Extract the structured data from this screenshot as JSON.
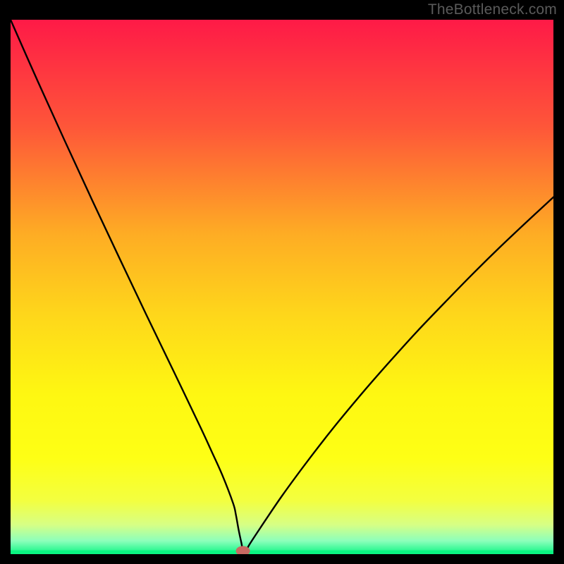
{
  "watermark": "TheBottleneck.com",
  "chart_data": {
    "type": "line",
    "title": "",
    "xlabel": "",
    "ylabel": "",
    "xlim": [
      0,
      100
    ],
    "ylim": [
      0,
      100
    ],
    "series": [
      {
        "name": "curve",
        "x": [
          0,
          5,
          10,
          15,
          20,
          25,
          30,
          35,
          37,
          39,
          41,
          41.5,
          42,
          42.5,
          43,
          44,
          46,
          50,
          55,
          60,
          65,
          70,
          75,
          80,
          85,
          90,
          95,
          100
        ],
        "y": [
          100,
          88.5,
          77.3,
          66.3,
          55.5,
          44.8,
          34.3,
          23.7,
          19.3,
          14.8,
          9.5,
          7.4,
          4.6,
          2.2,
          0.1,
          1.8,
          4.9,
          10.9,
          17.8,
          24.3,
          30.4,
          36.2,
          41.8,
          47.1,
          52.3,
          57.3,
          62.1,
          66.8
        ]
      }
    ],
    "marker": {
      "x": 42.8,
      "y": 0.6,
      "color": "#c86a62"
    },
    "background": {
      "type": "gradient",
      "stops": [
        {
          "pos": 0.0,
          "color": "#fe1a47"
        },
        {
          "pos": 0.2,
          "color": "#fe5639"
        },
        {
          "pos": 0.4,
          "color": "#feac24"
        },
        {
          "pos": 0.55,
          "color": "#fed61b"
        },
        {
          "pos": 0.7,
          "color": "#fef712"
        },
        {
          "pos": 0.82,
          "color": "#feff15"
        },
        {
          "pos": 0.9,
          "color": "#f3ff40"
        },
        {
          "pos": 0.945,
          "color": "#d7ff85"
        },
        {
          "pos": 0.975,
          "color": "#8dffbb"
        },
        {
          "pos": 1.0,
          "color": "#0bf582"
        }
      ]
    },
    "bottom_band": {
      "color": "#0bf582",
      "height_fraction": 0.007
    }
  }
}
